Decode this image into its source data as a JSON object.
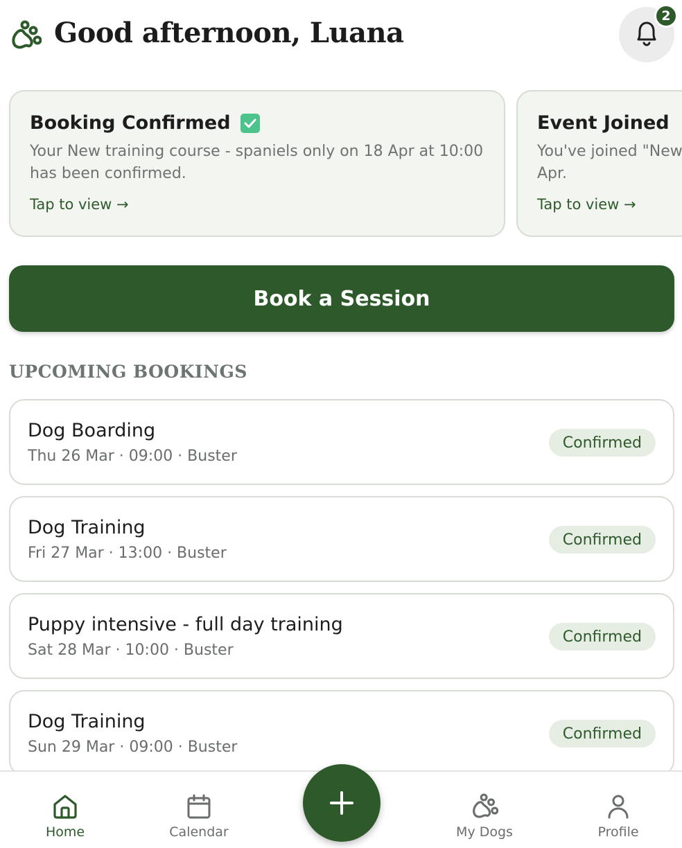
{
  "header": {
    "greeting": "Good afternoon, Luana",
    "notification_count": "2"
  },
  "notifications": [
    {
      "title": "Booking Confirmed",
      "body_line1": "Your New training course - spaniels only on 18 Apr at 10:00",
      "body_line2": "has been confirmed.",
      "cta": "Tap to view →"
    },
    {
      "title": "Event Joined",
      "body_line1": "You've joined \"New",
      "body_line2": "Apr.",
      "cta": "Tap to view →"
    }
  ],
  "book_button_label": "Book a Session",
  "upcoming": {
    "title": "UPCOMING BOOKINGS",
    "items": [
      {
        "title": "Dog Boarding",
        "meta": "Thu 26 Mar · 09:00 · Buster",
        "status": "Confirmed"
      },
      {
        "title": "Dog Training",
        "meta": "Fri 27 Mar · 13:00 · Buster",
        "status": "Confirmed"
      },
      {
        "title": "Puppy intensive - full day training",
        "meta": "Sat 28 Mar · 10:00 · Buster",
        "status": "Confirmed"
      },
      {
        "title": "Dog Training",
        "meta": "Sun 29 Mar · 09:00 · Buster",
        "status": "Confirmed"
      }
    ]
  },
  "nav": {
    "items": [
      {
        "label": "Home",
        "icon": "home-icon",
        "active": true
      },
      {
        "label": "Calendar",
        "icon": "calendar-icon",
        "active": false
      },
      {
        "label": "My Dogs",
        "icon": "paw-icon",
        "active": false
      },
      {
        "label": "Profile",
        "icon": "profile-icon",
        "active": false
      }
    ],
    "fab_icon": "plus-icon"
  },
  "colors": {
    "brand": "#2e5a2b",
    "card_bg": "#f3f5f1",
    "status_bg": "#e6ede3",
    "checkmark": "#4cc38a"
  }
}
